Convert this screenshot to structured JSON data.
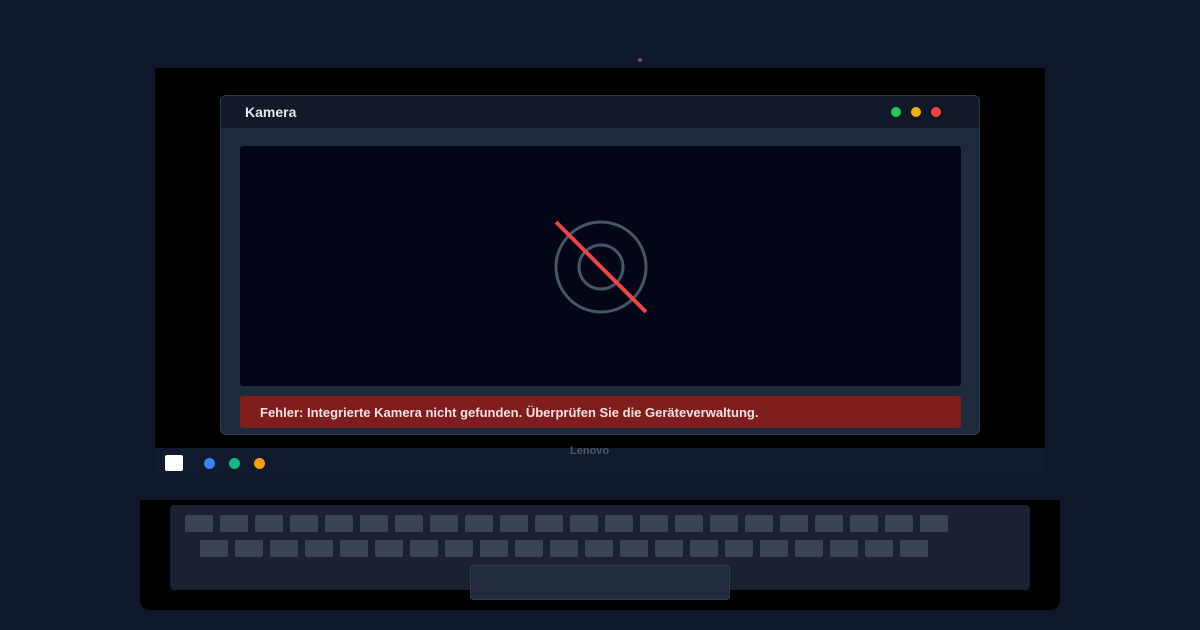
{
  "window": {
    "title": "Kamera",
    "controls": [
      {
        "name": "minimize-button",
        "color": "#22c55e"
      },
      {
        "name": "maximize-button",
        "color": "#eab308"
      },
      {
        "name": "close-button",
        "color": "#ef4444"
      }
    ]
  },
  "viewport": {
    "icon": "camera-off-icon",
    "icon_ring_color": "#475569",
    "slash_color": "#ef4444"
  },
  "error": {
    "message": "Fehler: Integrierte Kamera nicht gefunden. Überprüfen Sie die Geräteverwaltung.",
    "background": "#7f1d1d"
  },
  "taskbar": {
    "start_icon": "start-icon",
    "tray": [
      {
        "name": "tray-icon-blue",
        "color": "#3b82f6"
      },
      {
        "name": "tray-icon-green",
        "color": "#10b981"
      },
      {
        "name": "tray-icon-orange",
        "color": "#f59e0b"
      }
    ]
  },
  "device": {
    "brand": "Lenovo"
  }
}
